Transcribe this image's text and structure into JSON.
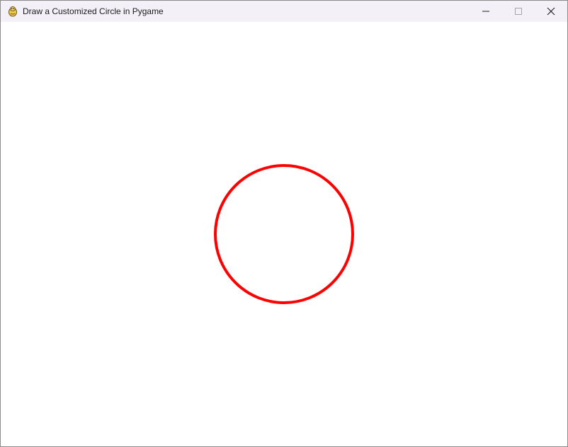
{
  "window": {
    "title": "Draw a Customized Circle in Pygame",
    "icon": "pygame-snake-icon",
    "controls": {
      "minimize_icon": "minimize-icon",
      "maximize_icon": "maximize-icon",
      "close_icon": "close-icon",
      "maximize_enabled": false
    }
  },
  "canvas": {
    "background_color": "#ffffff",
    "circle": {
      "color": "#ff0000",
      "fill": "none"
    }
  }
}
